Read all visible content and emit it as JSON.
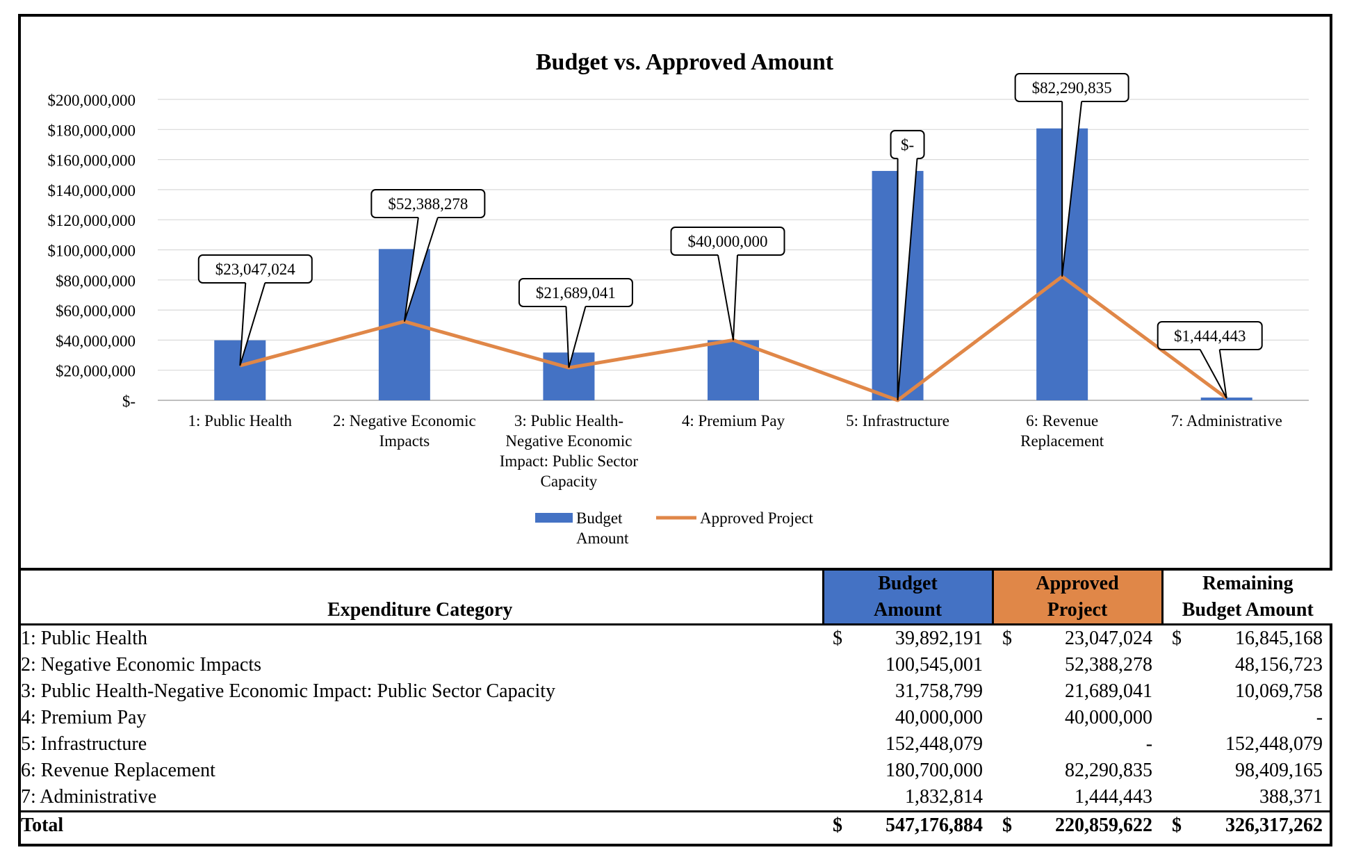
{
  "chart_data": {
    "type": "bar",
    "title": "Budget vs. Approved Amount",
    "categories": [
      "1: Public Health",
      "2: Negative Economic Impacts",
      "3: Public Health-Negative Economic Impact: Public Sector Capacity",
      "4: Premium Pay",
      "5: Infrastructure",
      "6: Revenue Replacement",
      "7: Administrative"
    ],
    "category_label_lines": [
      [
        "1: Public Health"
      ],
      [
        "2: Negative Economic",
        "Impacts"
      ],
      [
        "3: Public Health-",
        "Negative Economic",
        "Impact: Public Sector",
        "Capacity"
      ],
      [
        "4: Premium Pay"
      ],
      [
        "5: Infrastructure"
      ],
      [
        "6: Revenue",
        "Replacement"
      ],
      [
        "7: Administrative"
      ]
    ],
    "series": [
      {
        "name": "Budget Amount",
        "type": "bar",
        "color": "#4472c4",
        "values": [
          39892191,
          100545001,
          31758799,
          40000000,
          152448079,
          180700000,
          1832814
        ]
      },
      {
        "name": "Approved Project",
        "type": "line",
        "color": "#e08748",
        "values": [
          23047024,
          52388278,
          21689041,
          40000000,
          0,
          82290835,
          1444443
        ]
      }
    ],
    "data_labels": [
      "$23,047,024",
      "$52,388,278",
      "$21,689,041",
      "$40,000,000",
      "$-",
      "$82,290,835",
      "$1,444,443"
    ],
    "ylim": [
      0,
      200000000
    ],
    "yticks": [
      0,
      20000000,
      40000000,
      60000000,
      80000000,
      100000000,
      120000000,
      140000000,
      160000000,
      180000000,
      200000000
    ],
    "ytick_labels": [
      "$-",
      "$20,000,000",
      "$40,000,000",
      "$60,000,000",
      "$80,000,000",
      "$100,000,000",
      "$120,000,000",
      "$140,000,000",
      "$160,000,000",
      "$180,000,000",
      "$200,000,000"
    ],
    "grid": true,
    "legend_position": "bottom",
    "legend_label_lines": [
      [
        "Budget",
        "Amount"
      ],
      [
        "Approved Project"
      ]
    ]
  },
  "table": {
    "headers": {
      "category": "Expenditure Category",
      "budget": [
        "Budget",
        "Amount"
      ],
      "approved": [
        "Approved",
        "Project"
      ],
      "remaining": [
        "Remaining",
        "Budget Amount"
      ]
    },
    "currency_symbol": "$",
    "rows": [
      {
        "category": "1: Public Health",
        "budget": "39,892,191",
        "approved": "23,047,024",
        "remaining": "16,845,168",
        "show_currency": true
      },
      {
        "category": "2: Negative Economic Impacts",
        "budget": "100,545,001",
        "approved": "52,388,278",
        "remaining": "48,156,723",
        "show_currency": false
      },
      {
        "category": "3: Public Health-Negative Economic Impact: Public Sector Capacity",
        "budget": "31,758,799",
        "approved": "21,689,041",
        "remaining": "10,069,758",
        "show_currency": false
      },
      {
        "category": "4: Premium Pay",
        "budget": "40,000,000",
        "approved": "40,000,000",
        "remaining": "-",
        "show_currency": false
      },
      {
        "category": "5: Infrastructure",
        "budget": "152,448,079",
        "approved": "-",
        "remaining": "152,448,079",
        "show_currency": false
      },
      {
        "category": "6: Revenue Replacement",
        "budget": "180,700,000",
        "approved": "82,290,835",
        "remaining": "98,409,165",
        "show_currency": false
      },
      {
        "category": "7: Administrative",
        "budget": "1,832,814",
        "approved": "1,444,443",
        "remaining": "388,371",
        "show_currency": false
      }
    ],
    "total": {
      "category": "Total",
      "budget": "547,176,884",
      "approved": "220,859,622",
      "remaining": "326,317,262"
    }
  }
}
